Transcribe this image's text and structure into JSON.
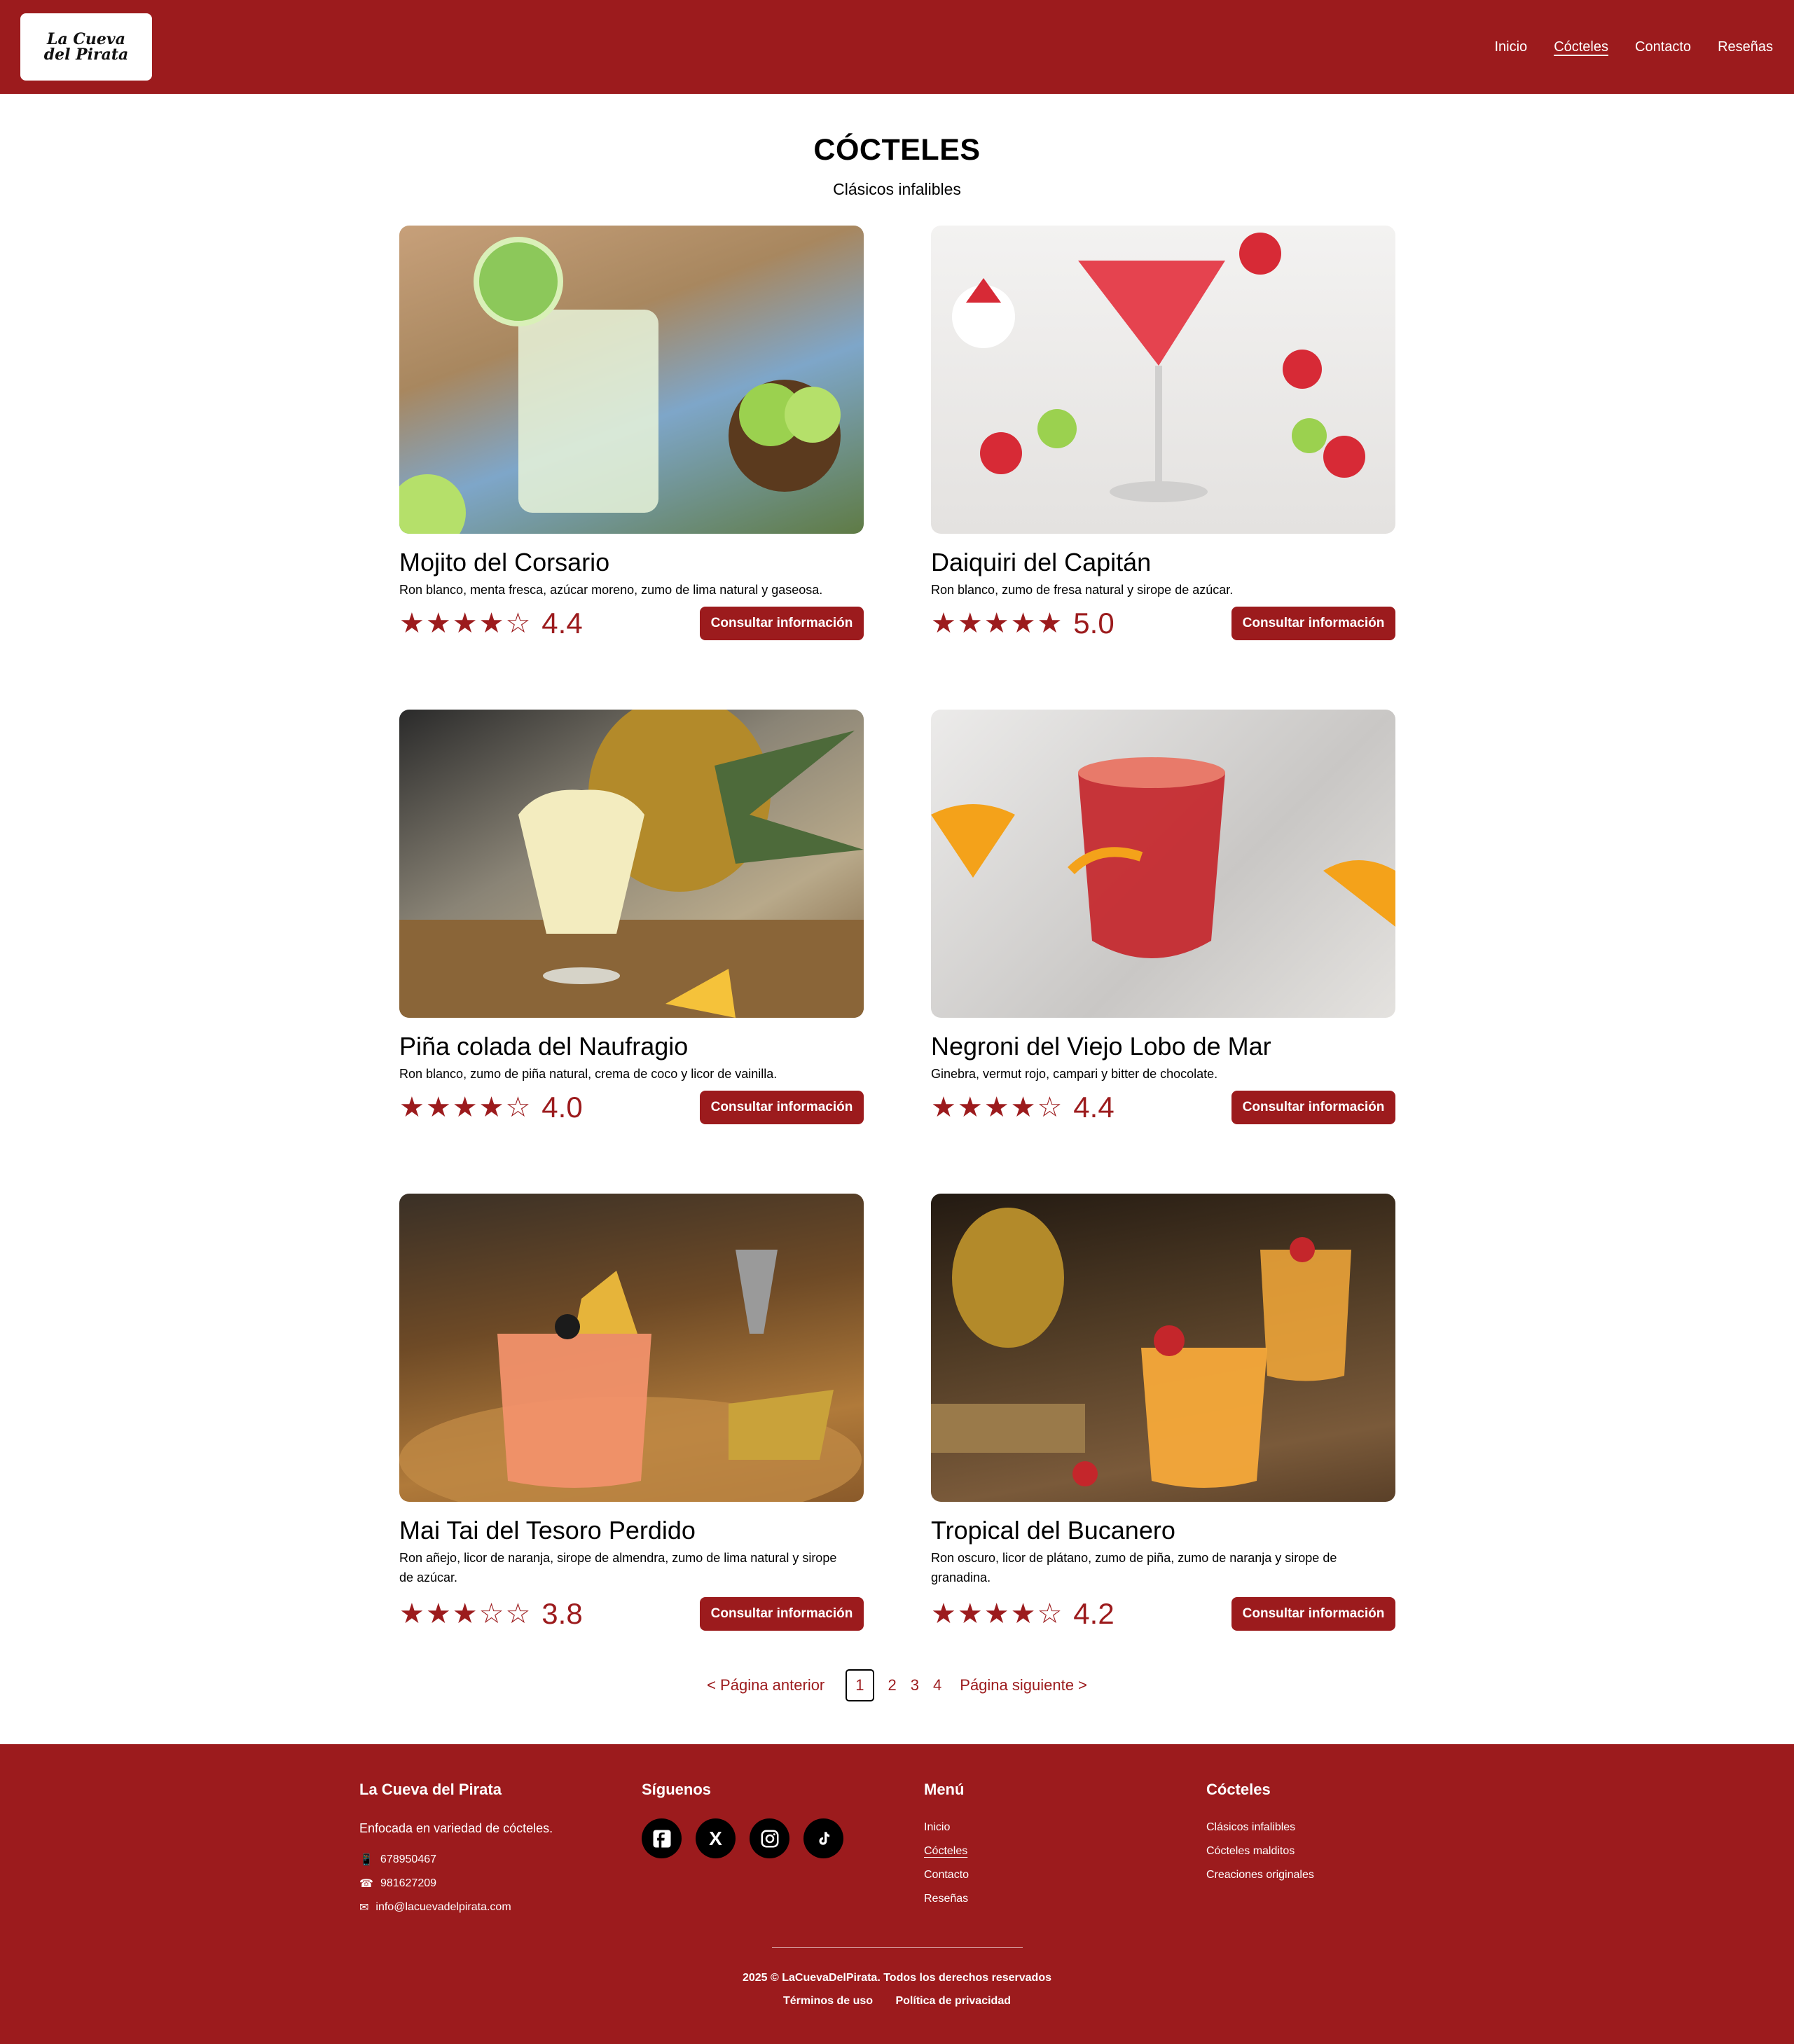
{
  "header": {
    "logo_top": "La Cueva",
    "logo_bottom": "del Pirata",
    "nav": [
      {
        "label": "Inicio"
      },
      {
        "label": "Cócteles"
      },
      {
        "label": "Contacto"
      },
      {
        "label": "Reseñas"
      }
    ]
  },
  "page": {
    "title": "CÓCTELES",
    "subtitle": "Clásicos infalibles"
  },
  "cards": [
    {
      "name": "Mojito del Corsario",
      "desc": "Ron blanco, menta fresca, azúcar moreno, zumo de lima natural y gaseosa.",
      "stars": "★★★★☆",
      "rating": "4.4",
      "button": "Consultar información",
      "image": "mojito-photo",
      "bg": "#6b8a5a",
      "accent": "#cfe6b0"
    },
    {
      "name": "Daiquiri del Capitán",
      "desc": "Ron blanco, zumo de fresa natural y sirope de azúcar.",
      "stars": "★★★★★",
      "rating": "5.0",
      "button": "Consultar información",
      "image": "daiquiri-photo",
      "bg": "#ecebea",
      "accent": "#e5434f"
    },
    {
      "name": "Piña colada del Naufragio",
      "desc": "Ron blanco, zumo de piña natural, crema de coco y licor de vainilla.",
      "stars": "★★★★☆",
      "rating": "4.0",
      "button": "Consultar información",
      "image": "pina-colada-photo",
      "bg": "#5e5a50",
      "accent": "#f3ecbf"
    },
    {
      "name": "Negroni del Viejo Lobo de Mar",
      "desc": "Ginebra, vermut rojo, campari y bitter de chocolate.",
      "stars": "★★★★☆",
      "rating": "4.4",
      "button": "Consultar información",
      "image": "negroni-photo",
      "bg": "#d8d6d4",
      "accent": "#c4262b"
    },
    {
      "name": "Mai Tai del Tesoro Perdido",
      "desc": "Ron añejo, licor de naranja, sirope de almendra, zumo de lima natural y sirope de azúcar.",
      "stars": "★★★☆☆",
      "rating": "3.8",
      "button": "Consultar información",
      "image": "mai-tai-photo",
      "bg": "#6e4a26",
      "accent": "#f1916a"
    },
    {
      "name": "Tropical del Bucanero",
      "desc": "Ron oscuro, licor de plátano, zumo de piña, zumo de naranja y sirope de granadina.",
      "stars": "★★★★☆",
      "rating": "4.2",
      "button": "Consultar información",
      "image": "tropical-photo",
      "bg": "#4e3a24",
      "accent": "#f5a93a"
    }
  ],
  "pagination": {
    "prev": "< Página anterior",
    "pages": [
      "1",
      "2",
      "3",
      "4"
    ],
    "current": "1",
    "next": "Página siguiente >"
  },
  "footer": {
    "brand_title": "La Cueva del Pirata",
    "brand_text": "Enfocada en variedad de cócteles.",
    "phone_mobile": "678950467",
    "phone_land": "981627209",
    "email": "info@lacuevadelpirata.com",
    "social_title": "Síguenos",
    "social": [
      "facebook-icon",
      "x-icon",
      "instagram-icon",
      "tiktok-icon"
    ],
    "menu_title": "Menú",
    "menu": [
      "Inicio",
      "Cócteles",
      "Contacto",
      "Reseñas"
    ],
    "cocktails_title": "Cócteles",
    "cocktails": [
      "Clásicos infalibles",
      "Cócteles malditos",
      "Creaciones originales"
    ],
    "copyright": "2025 © LaCuevaDelPirata. Todos los derechos reservados",
    "terms": "Términos de uso",
    "privacy": "Política de privacidad"
  },
  "colors": {
    "brand": "#9c1b1d",
    "text": "#000000",
    "white": "#ffffff"
  }
}
